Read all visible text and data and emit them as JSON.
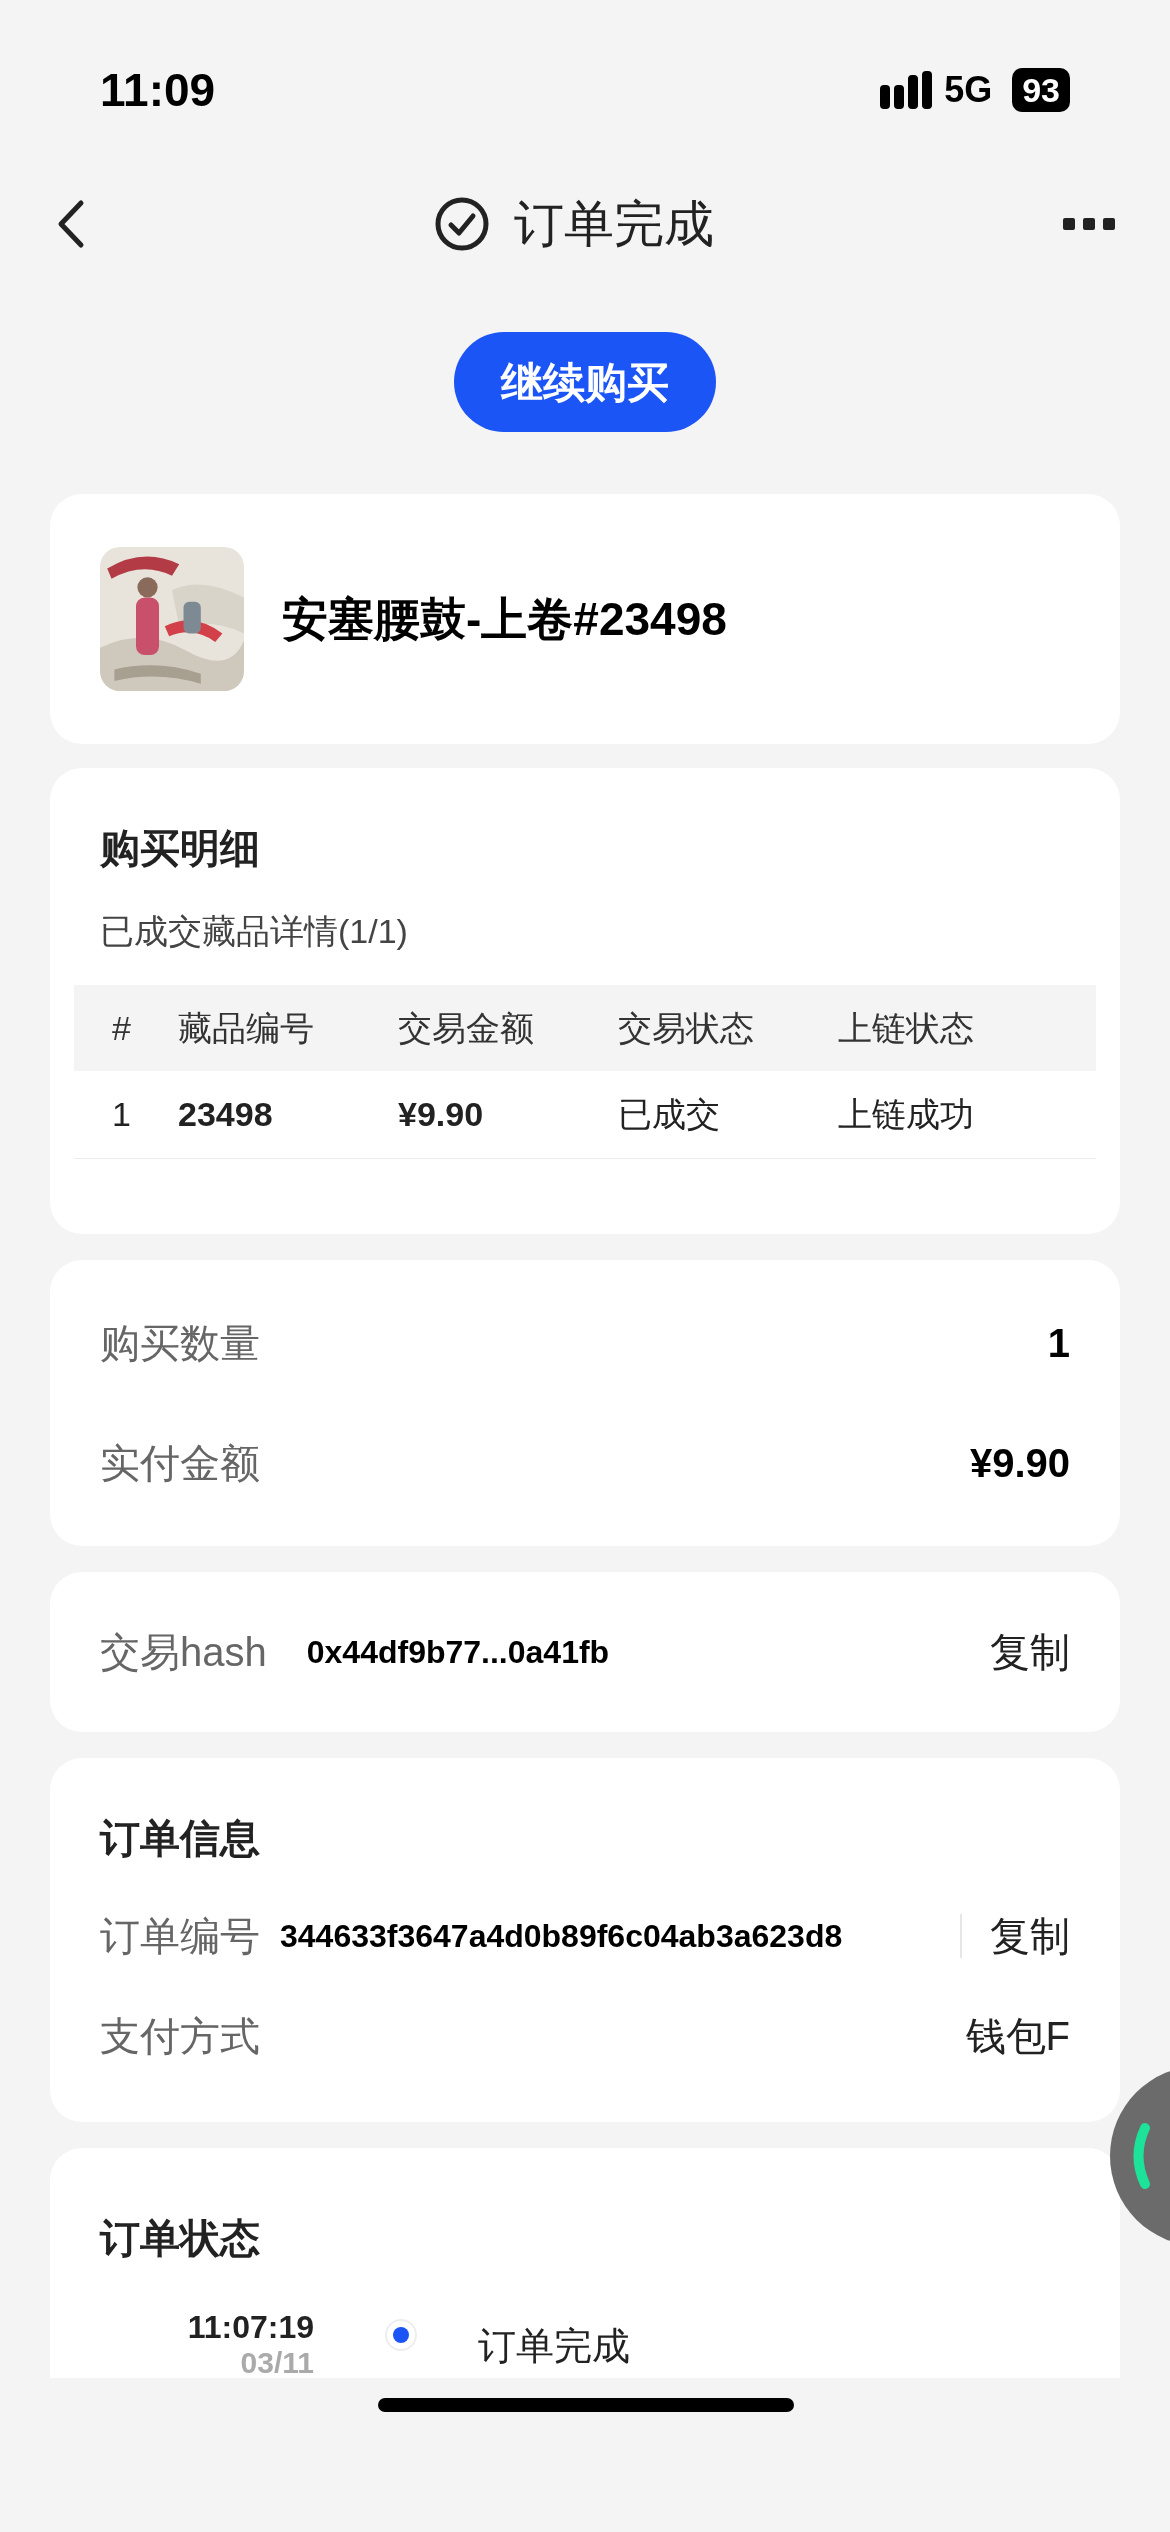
{
  "status_bar": {
    "time": "11:09",
    "network": "5G",
    "battery": "93"
  },
  "header": {
    "title": "订单完成"
  },
  "continue_button": "继续购买",
  "product": {
    "name": "安塞腰鼓-上卷#23498"
  },
  "purchase_detail": {
    "title": "购买明细",
    "subtitle": "已成交藏品详情(1/1)",
    "table": {
      "columns": [
        "#",
        "藏品编号",
        "交易金额",
        "交易状态",
        "上链状态"
      ],
      "rows": [
        [
          "1",
          "23498",
          "¥9.90",
          "已成交",
          "上链成功"
        ]
      ]
    }
  },
  "summary": [
    {
      "label": "购买数量",
      "value": "1"
    },
    {
      "label": "实付金额",
      "value": "¥9.90"
    }
  ],
  "hash": {
    "label": "交易hash",
    "value": "0x44df9b77...0a41fb",
    "action": "复制"
  },
  "order_info": {
    "title": "订单信息",
    "rows": [
      {
        "kind": "copy",
        "label": "订单编号",
        "value": "344633f3647a4d0b89f6c04ab3a623d8",
        "action": "复制"
      },
      {
        "kind": "plain",
        "label": "支付方式",
        "value": "钱包F"
      }
    ]
  },
  "order_status": {
    "title": "订单状态",
    "events": [
      {
        "time": "11:07:19",
        "date": "03/11",
        "text": "订单完成"
      }
    ]
  }
}
